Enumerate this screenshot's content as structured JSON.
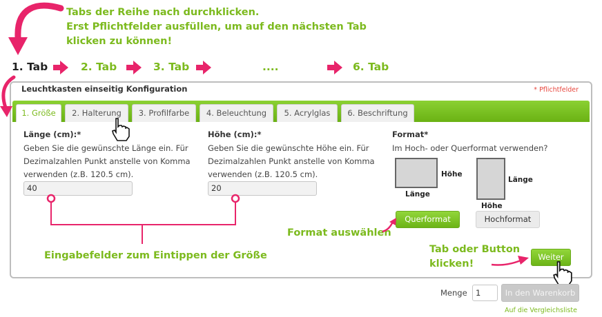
{
  "intro": {
    "line1": "Tabs der Reihe nach durchklicken.",
    "line2": "Erst Pflichtfelder ausfüllen, um auf den nächsten Tab",
    "line3": "klicken zu können!"
  },
  "steps": [
    "1. Tab",
    "2. Tab",
    "3. Tab",
    "....",
    "6. Tab"
  ],
  "panel": {
    "title": "Leuchtkasten einseitig Konfiguration",
    "required_note": "* Pflichtfelder"
  },
  "tabs": [
    "1. Größe",
    "2. Halterung",
    "3. Profilfarbe",
    "4. Beleuchtung",
    "5. Acrylglas",
    "6. Beschriftung"
  ],
  "fields": {
    "length": {
      "label": "Länge (cm):",
      "asterisk": "*",
      "help1": "Geben Sie die gewünschte Länge ein. Für",
      "help2": "Dezimalzahlen Punkt anstelle von Komma",
      "help3": "verwenden (z.B. 120.5 cm).",
      "value": "40"
    },
    "height": {
      "label": "Höhe (cm):",
      "asterisk": "*",
      "help1": "Geben Sie die gewünschte Höhe ein. Für",
      "help2": "Dezimalzahlen Punkt anstelle von Komma",
      "help3": "verwenden (z.B. 120.5 cm).",
      "value": "20"
    }
  },
  "format": {
    "label": "Format",
    "asterisk": "*",
    "question": "Im Hoch- oder Querformat verwenden?",
    "landscape_side": "Höhe",
    "landscape_bottom": "Länge",
    "portrait_side": "Länge",
    "portrait_bottom": "Höhe",
    "landscape_button": "Querformat",
    "portrait_button": "Hochformat"
  },
  "annotations": {
    "format_choose": "Format auswählen",
    "input_fields": "Eingabefelder zum Eintippen der Größe",
    "tab_or_button_1": "Tab oder Button",
    "tab_or_button_2": "klicken!"
  },
  "buttons": {
    "next": "Weiter"
  },
  "cart": {
    "quantity_label": "Menge",
    "quantity_value": "1",
    "add_button": "In den Warenkorb",
    "compare_link": "Auf die Vergleichsliste"
  },
  "colors": {
    "accent_green": "#7cba1e",
    "annotation_pink": "#e8246a",
    "required_red": "#e8453c"
  },
  "icons": [
    "curved-arrow-icon",
    "step-arrow-icon",
    "hand-cursor-icon"
  ]
}
